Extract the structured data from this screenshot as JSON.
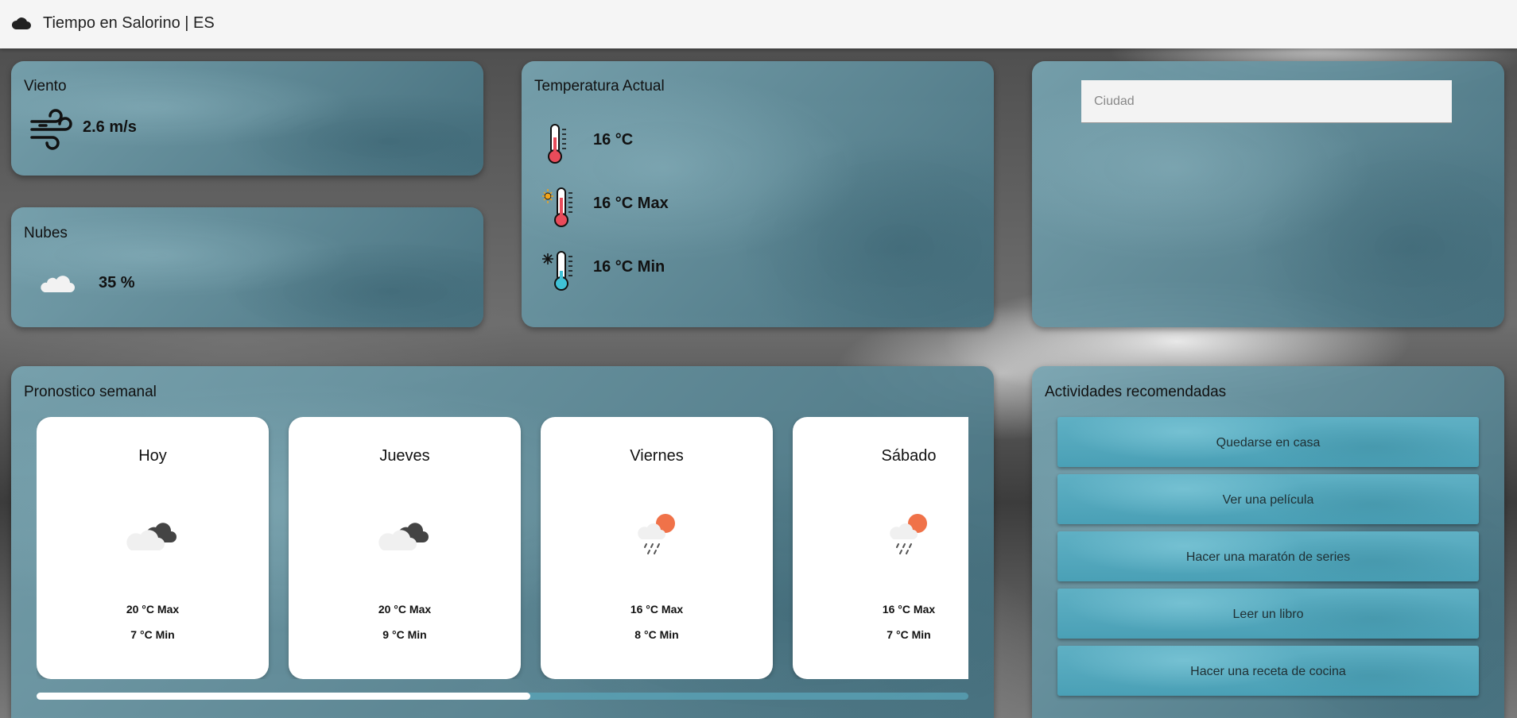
{
  "appbar": {
    "title": "Tiempo en Salorino | ES",
    "logo_icon": "cloud-icon"
  },
  "wind": {
    "title": "Viento",
    "value": "2.6 m/s",
    "icon": "wind-icon"
  },
  "clouds": {
    "title": "Nubes",
    "value": "35 %",
    "icon": "cloud-icon"
  },
  "temperature": {
    "title": "Temperatura Actual",
    "current": "16 °C",
    "max": "16 °C Max",
    "min": "16 °C Min"
  },
  "search": {
    "placeholder": "Ciudad"
  },
  "forecast": {
    "title": "Pronostico semanal",
    "scroll_fraction": 0.53,
    "days": [
      {
        "name": "Hoy",
        "max": "20 °C Max",
        "min": "7 °C Min",
        "icon": "cloudy-icon"
      },
      {
        "name": "Jueves",
        "max": "20 °C Max",
        "min": "9 °C Min",
        "icon": "cloudy-icon"
      },
      {
        "name": "Viernes",
        "max": "16 °C Max",
        "min": "8 °C Min",
        "icon": "sun-rain-icon"
      },
      {
        "name": "Sábado",
        "max": "16 °C Max",
        "min": "7 °C Min",
        "icon": "sun-rain-icon"
      }
    ]
  },
  "activities": {
    "title": "Actividades recomendadas",
    "items": [
      "Quedarse en casa",
      "Ver una película",
      "Hacer una maratón de series",
      "Leer un libro",
      "Hacer una receta de cocina"
    ]
  }
}
